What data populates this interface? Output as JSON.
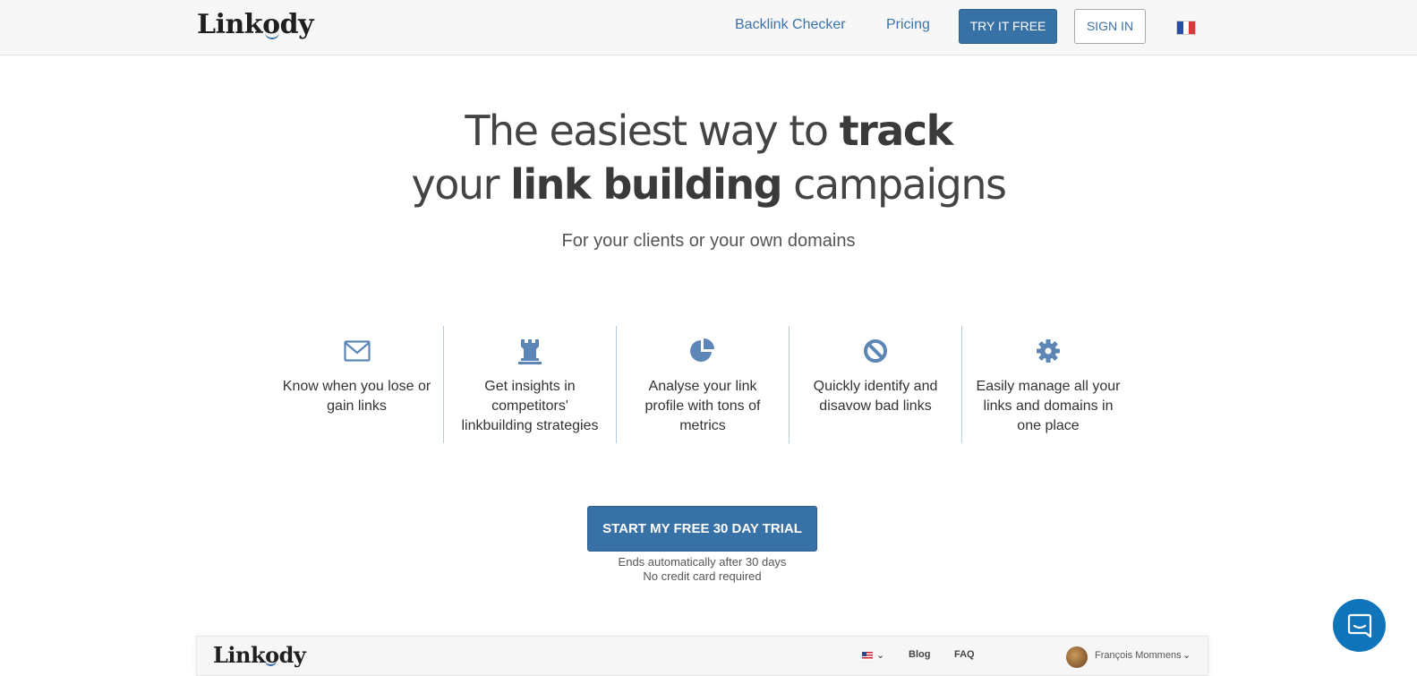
{
  "header": {
    "logo_text": "Linkody",
    "nav_backlink": "Backlink Checker",
    "nav_pricing": "Pricing",
    "try_button": "TRY IT FREE",
    "signin_button": "SIGN IN",
    "flag_colors": [
      "#2b4ea5",
      "#ffffff",
      "#d63a3a"
    ]
  },
  "hero": {
    "line1_pre": "The easiest way to ",
    "line1_bold": "track",
    "line2_pre": "your ",
    "line2_bold": "link building",
    "line2_post": " campaigns",
    "subtitle": "For your clients or your own domains"
  },
  "features": [
    {
      "icon": "envelope-icon",
      "line1": "Know when you lose or",
      "line2": "gain links",
      "line3": ""
    },
    {
      "icon": "rook-icon",
      "line1": "Get insights in",
      "line2": "competitors'",
      "line3": "linkbuilding strategies"
    },
    {
      "icon": "pie-chart-icon",
      "line1": "Analyse your link",
      "line2": "profile with tons of",
      "line3": "metrics"
    },
    {
      "icon": "ban-icon",
      "line1": "Quickly identify and",
      "line2": "disavow bad links",
      "line3": ""
    },
    {
      "icon": "gear-icon",
      "line1": "Easily manage all your",
      "line2": "links and domains in",
      "line3": "one place"
    }
  ],
  "cta": {
    "button": "START MY FREE 30 DAY TRIAL",
    "note1": "Ends automatically after 30 days",
    "note2": "No credit card required"
  },
  "preview": {
    "logo_text": "Linkody",
    "blog": "Blog",
    "faq": "FAQ",
    "user_name": "François Mommens"
  },
  "colors": {
    "accent": "#3871a6",
    "icon": "#5b86b6",
    "chat": "#0f74b9"
  }
}
